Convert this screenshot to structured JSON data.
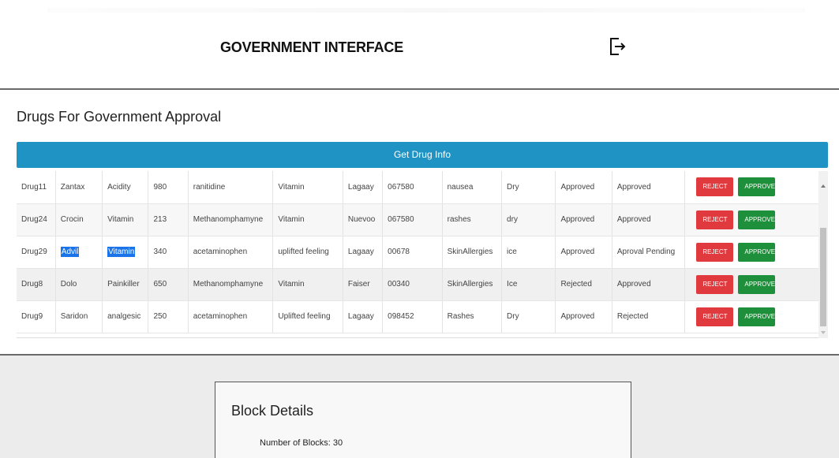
{
  "header": {
    "title": "GOVERNMENT INTERFACE",
    "logout_icon": "logout-icon"
  },
  "section": {
    "title": "Drugs For Government Approval"
  },
  "get_info": {
    "label": "Get Drug Info"
  },
  "drugs": [
    {
      "id": "Drug11",
      "name": "Zantax",
      "category": "Acidity",
      "qty": "980",
      "composition": "ranitidine",
      "effect": "Vitamin",
      "manufacturer": "Lagaay",
      "code": "067580",
      "side_effect": "nausea",
      "storage": "Dry",
      "status1": "Approved",
      "status2": "Approved",
      "reject": "REJECT",
      "approve": "APPROVE"
    },
    {
      "id": "Drug24",
      "name": "Crocin",
      "category": "Vitamin",
      "qty": "213",
      "composition": "Methanomphamyne",
      "effect": "Vitamin",
      "manufacturer": "Nuevoo",
      "code": "067580",
      "side_effect": "rashes",
      "storage": "dry",
      "status1": "Approved",
      "status2": "Approved",
      "reject": "REJECT",
      "approve": "APPROVE"
    },
    {
      "id": "Drug29",
      "name": "Advil",
      "category": "Vitamin",
      "qty": "340",
      "composition": "acetaminophen",
      "effect": "uplifted feeling",
      "manufacturer": "Lagaay",
      "code": "00678",
      "side_effect": "SkinAllergies",
      "storage": "ice",
      "status1": "Approved",
      "status2": "Aproval Pending",
      "reject": "REJECT",
      "approve": "APPROVE"
    },
    {
      "id": "Drug8",
      "name": "Dolo",
      "category": "Painkiller",
      "qty": "650",
      "composition": "Methanomphamyne",
      "effect": "Vitamin",
      "manufacturer": "Faiser",
      "code": "00340",
      "side_effect": "SkinAllergies",
      "storage": "Ice",
      "status1": "Rejected",
      "status2": "Approved",
      "reject": "REJECT",
      "approve": "APPROVE"
    },
    {
      "id": "Drug9",
      "name": "Saridon",
      "category": "analgesic",
      "qty": "250",
      "composition": "acetaminophen",
      "effect": "Uplifted feeling",
      "manufacturer": "Lagaay",
      "code": "098452",
      "side_effect": "Rashes",
      "storage": "Dry",
      "status1": "Approved",
      "status2": "Rejected",
      "reject": "REJECT",
      "approve": "APPROVE"
    }
  ],
  "block": {
    "title": "Block Details",
    "count_label": "Number of Blocks: 30"
  },
  "colors": {
    "primary": "#1f93c4",
    "reject": "#e0393e",
    "approve": "#1e8f3a",
    "selection": "#1a73e8"
  }
}
